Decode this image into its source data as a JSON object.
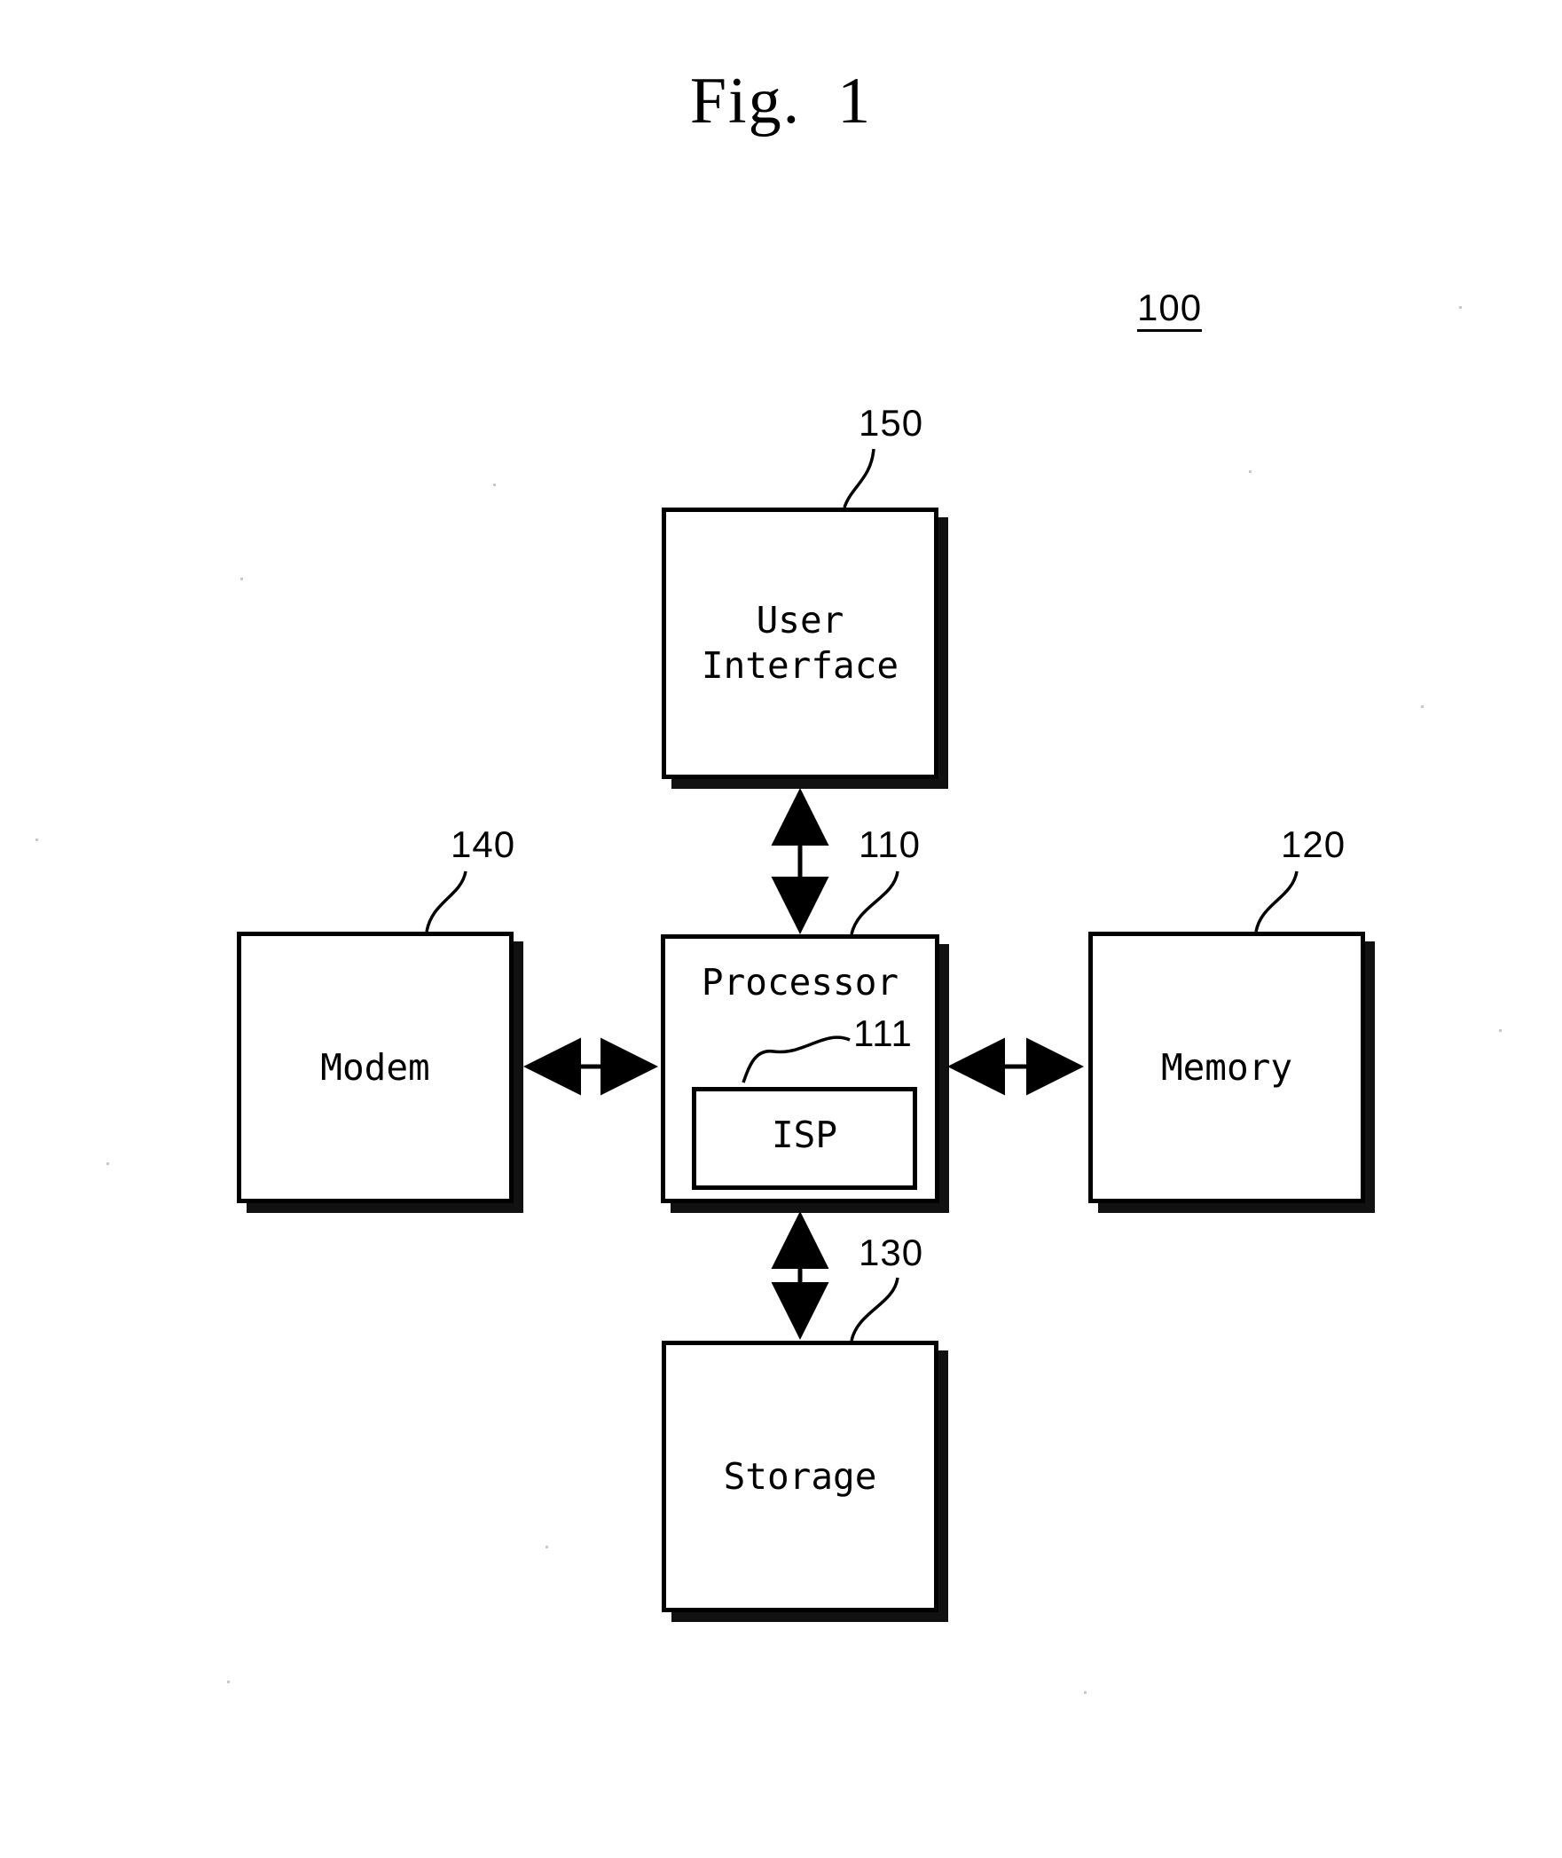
{
  "figure": {
    "title": "Fig.  1",
    "system_number": "100"
  },
  "blocks": {
    "user_interface": {
      "label": "User\nInterface",
      "ref": "150"
    },
    "processor": {
      "label": "Processor",
      "ref": "110"
    },
    "isp": {
      "label": "ISP",
      "ref": "111"
    },
    "modem": {
      "label": "Modem",
      "ref": "140"
    },
    "memory": {
      "label": "Memory",
      "ref": "120"
    },
    "storage": {
      "label": "Storage",
      "ref": "130"
    }
  },
  "connections": [
    {
      "from": "processor",
      "to": "user_interface",
      "style": "double-arrow"
    },
    {
      "from": "processor",
      "to": "modem",
      "style": "double-arrow"
    },
    {
      "from": "processor",
      "to": "memory",
      "style": "double-arrow"
    },
    {
      "from": "processor",
      "to": "storage",
      "style": "double-arrow"
    }
  ],
  "colors": {
    "ink": "#000000",
    "shadow": "#111111",
    "paper": "#ffffff"
  }
}
